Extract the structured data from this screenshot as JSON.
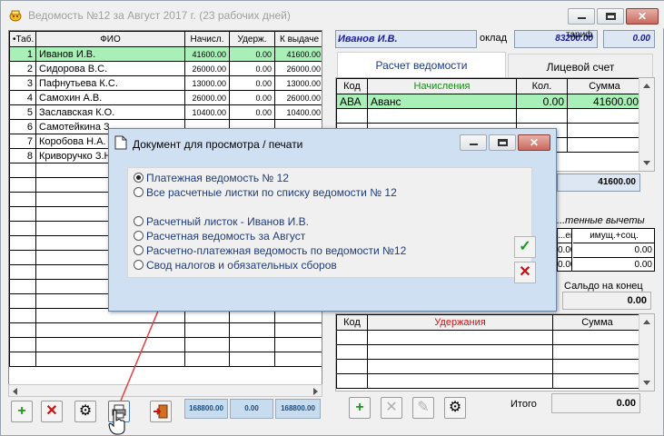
{
  "window": {
    "title": "Ведомость №12 за Август 2017 г. (23 рабочих дней)"
  },
  "left_grid": {
    "headers": [
      "•Таб.",
      "ФИО",
      "Начисл.",
      "Удерж.",
      "К выдаче"
    ],
    "rows": [
      {
        "idx": "1",
        "name": "Иванов И.В.",
        "nach": "41600.00",
        "uder": "0.00",
        "vyd": "41600.00"
      },
      {
        "idx": "2",
        "name": "Сидорова В.С.",
        "nach": "26000.00",
        "uder": "0.00",
        "vyd": "26000.00"
      },
      {
        "idx": "3",
        "name": "Пафнутьева К.С.",
        "nach": "13000.00",
        "uder": "0.00",
        "vyd": "13000.00"
      },
      {
        "idx": "4",
        "name": "Самохин А.В.",
        "nach": "26000.00",
        "uder": "0.00",
        "vyd": "26000.00"
      },
      {
        "idx": "5",
        "name": "Заславская К.О.",
        "nach": "10400.00",
        "uder": "0.00",
        "vyd": "10400.00"
      },
      {
        "idx": "6",
        "name": "Самотейкина З",
        "nach": "",
        "uder": "",
        "vyd": ""
      },
      {
        "idx": "7",
        "name": "Коробова Н.А.",
        "nach": "",
        "uder": "",
        "vyd": ""
      },
      {
        "idx": "8",
        "name": "Криворучко З.Н",
        "nach": "",
        "uder": "",
        "vyd": ""
      }
    ],
    "totals": {
      "nach": "168800.00",
      "uder": "0.00",
      "vyd": "168800.00"
    }
  },
  "employee": {
    "name": "Иванов И.В.",
    "oklad_label": "оклад",
    "oklad_value": "83200.00",
    "tarif_label": "тариф",
    "tarif_value": "0.00"
  },
  "tabs": {
    "calc": "Расчет ведомости",
    "account": "Лицевой счет"
  },
  "accruals": {
    "headers": [
      "Код",
      "Начисления",
      "Кол.",
      "Сумма"
    ],
    "rows": [
      {
        "code": "АВА",
        "name": "Аванс",
        "qty": "0.00",
        "sum": "41600.00"
      }
    ],
    "total": "41600.00"
  },
  "deductions_partial": {
    "caption": "...тенные вычеты",
    "col1": "...ей",
    "col2": "имущ.+соц.",
    "row1": [
      "0.00",
      "0.00"
    ],
    "row2": [
      "0.00",
      "0.00"
    ]
  },
  "saldo": {
    "label": "Сальдо на конец",
    "value": "0.00"
  },
  "withholdings": {
    "headers": [
      "Код",
      "Удержания",
      "Сумма"
    ]
  },
  "itogo": {
    "label": "Итого",
    "value": "0.00"
  },
  "dialog": {
    "title": "Документ для  просмотра / печати",
    "options": [
      {
        "label": "Платежная ведомость № 12",
        "selected": true
      },
      {
        "label": "Все расчетные листки по списку ведомости № 12",
        "selected": false
      },
      {
        "label": "Расчетный листок - Иванов И.В.",
        "selected": false
      },
      {
        "label": "Расчетная ведомость за Август",
        "selected": false
      },
      {
        "label": "Расчетно-платежная ведомость по ведомости №12",
        "selected": false
      },
      {
        "label": "Свод налогов и обязательных сборов",
        "selected": false
      }
    ]
  },
  "colors": {
    "selected_row": "#a9f0b8",
    "field_blue": "#dde7f3",
    "accrual_header": "#1a8a1a",
    "withholding_header": "#d01010",
    "link_text": "#1f3c7a",
    "arrow": "#e04040"
  },
  "icons": {
    "add": "plus-icon",
    "delete": "cross-icon",
    "settings": "gear-icon",
    "print": "printer-icon",
    "exit": "exit-door-icon",
    "edit": "pencil-icon",
    "ok": "checkmark-icon",
    "cancel": "cross-icon"
  }
}
